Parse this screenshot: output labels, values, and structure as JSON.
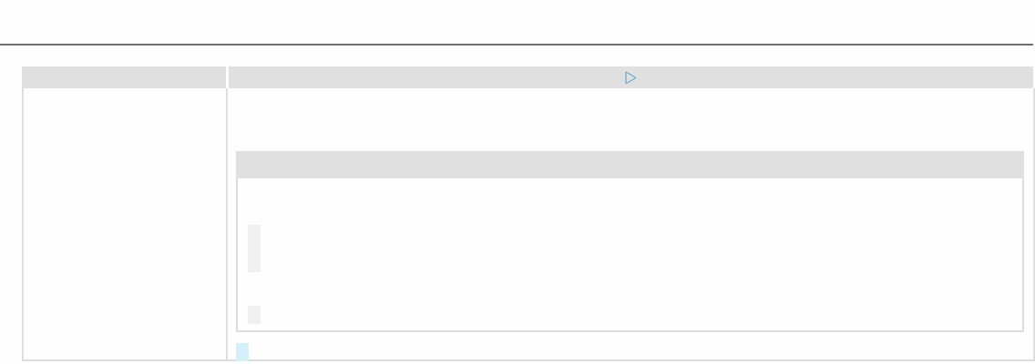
{
  "run_button": {
    "kind": "play"
  },
  "output_panel": {
    "blocks": [
      {
        "kind": "tall"
      },
      {
        "kind": "short"
      }
    ]
  },
  "cursor": {
    "kind": "highlight"
  }
}
